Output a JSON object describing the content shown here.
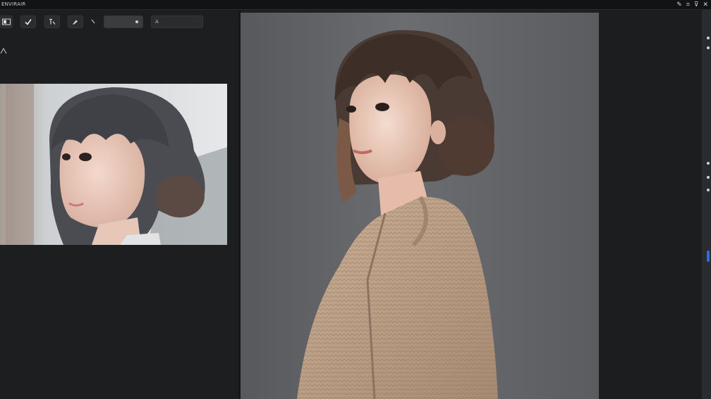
{
  "window": {
    "title": "ENVIRAIR",
    "title_icons": [
      "pen-icon",
      "crop-icon",
      "filter-icon",
      "close-icon"
    ]
  },
  "toolbar": {
    "tools": [
      {
        "name": "image-tool",
        "icon": "image-icon"
      },
      {
        "name": "check-tool",
        "icon": "check-icon"
      },
      {
        "name": "text-tool",
        "icon": "text-icon"
      },
      {
        "name": "brush-tool",
        "icon": "brush-icon"
      },
      {
        "name": "pointer-tool",
        "icon": "pointer-icon"
      }
    ],
    "field_value": "",
    "field2_label": "A"
  },
  "left_panel": {
    "side_icon": "triangle-icon",
    "side_label": ""
  },
  "colors": {
    "accent": "#2d6fd8",
    "panel": "#1d1e20",
    "canvas": "#64666a"
  }
}
